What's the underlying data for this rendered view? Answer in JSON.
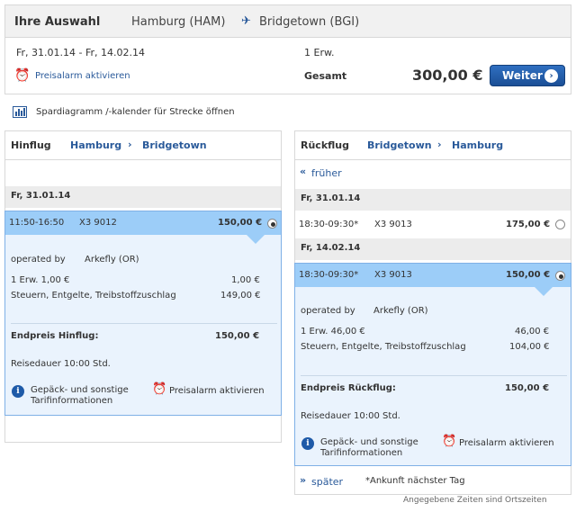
{
  "header": {
    "title": "Ihre Auswahl",
    "route_from": "Hamburg (HAM)",
    "route_to": "Bridgetown (BGI)",
    "plane_icon": "plane-icon"
  },
  "summary": {
    "dates": "Fr, 31.01.14 - Fr, 14.02.14",
    "passengers": "1 Erw.",
    "price_alert": "Preisalarm aktivieren",
    "total_label": "Gesamt",
    "total_price": "300,00 €",
    "continue_label": "Weiter"
  },
  "calendar_link": "Spardiagramm /-kalender für Strecke öffnen",
  "outbound": {
    "title": "Hinflug",
    "from": "Hamburg",
    "to": "Bridgetown",
    "date": "Fr, 31.01.14",
    "flight": {
      "time": "11:50-16:50",
      "number": "X3 9012",
      "price": "150,00 €"
    },
    "operated_label": "operated by",
    "operator": "Arkefly (OR)",
    "fare_label": "1 Erw. 1,00 €",
    "fare_value": "1,00 €",
    "taxes_label": "Steuern, Entgelte, Treibstoffzuschlag",
    "taxes_value": "149,00 €",
    "total_label": "Endpreis Hinflug:",
    "total_value": "150,00 €",
    "duration": "Reisedauer 10:00 Std.",
    "info_link": "Gepäck- und sonstige Tarifinformationen",
    "alert_link": "Preisalarm aktivieren"
  },
  "return": {
    "title": "Rückflug",
    "from": "Bridgetown",
    "to": "Hamburg",
    "earlier": "früher",
    "date1": "Fr, 31.01.14",
    "flight1": {
      "time": "18:30-09:30*",
      "number": "X3 9013",
      "price": "175,00 €"
    },
    "date2": "Fr, 14.02.14",
    "flight2": {
      "time": "18:30-09:30*",
      "number": "X3 9013",
      "price": "150,00 €"
    },
    "operated_label": "operated by",
    "operator": "Arkefly (OR)",
    "fare_label": "1 Erw. 46,00 €",
    "fare_value": "46,00 €",
    "taxes_label": "Steuern, Entgelte, Treibstoffzuschlag",
    "taxes_value": "104,00 €",
    "total_label": "Endpreis Rückflug:",
    "total_value": "150,00 €",
    "duration": "Reisedauer 10:00 Std.",
    "info_link": "Gepäck- und sonstige Tarifinformationen",
    "alert_link": "Preisalarm aktivieren",
    "later": "später",
    "arrival_note": "*Ankunft nächster Tag"
  },
  "footer_note": "Angegebene Zeiten sind Ortszeiten",
  "colors": {
    "brand": "#1b4f96",
    "link": "#2a5a9a",
    "selected_bg": "#eaf3fd",
    "selected_bar": "#9ccdf8"
  }
}
